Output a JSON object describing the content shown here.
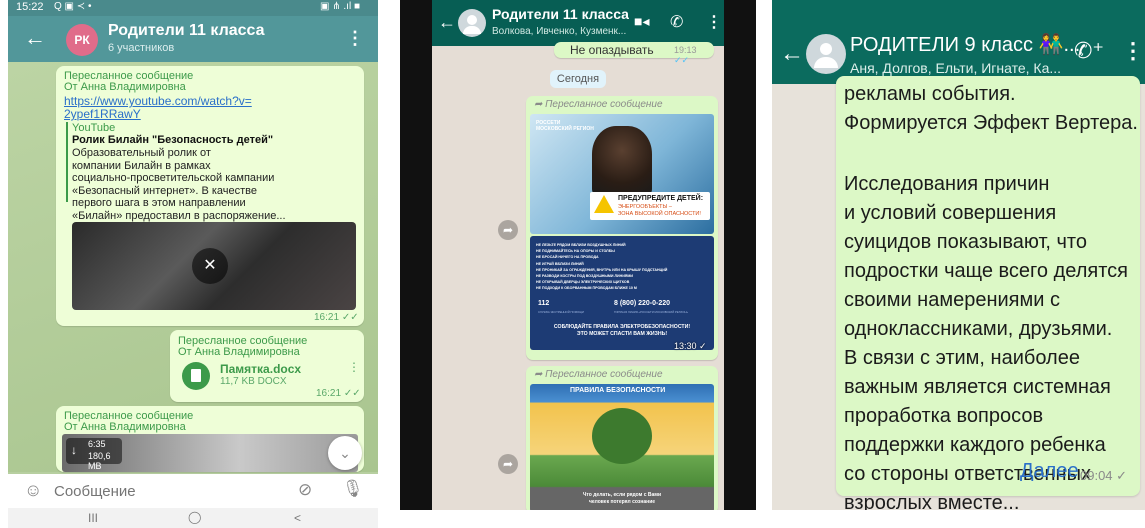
{
  "panel1": {
    "status": {
      "time": "15:22",
      "left_icons": "Q ▣ ≺ •",
      "right_icons": "▣ ⋔ .ıl ■"
    },
    "chat": {
      "avatar_initials": "РК",
      "title": "Родители 11 класса",
      "subtitle": "6 участников",
      "avatar_color": "#e06c8a"
    },
    "msg1": {
      "fwd_label": "Пересланное сообщение",
      "fwd_from": "От Анна Владимировна",
      "link": "https://www.youtube.com/watch?v=\n2ypef1RRawY",
      "source": "YouTube",
      "title": "Ролик Билайн \"Безопасность детей\"",
      "body": "Образовательный ролик от\nкомпании Билайн в рамках\nсоциально-просветительской кампании\n«Безопасный интернет». В качестве\nпервого шага в этом направлении\n«Билайн» предоставил в распоряжение...",
      "time": "16:21"
    },
    "msg2": {
      "fwd_label": "Пересланное сообщение",
      "fwd_from": "От Анна Владимировна",
      "file_name": "Памятка.docx",
      "file_meta": "11,7 KB DOCX",
      "time": "16:21"
    },
    "msg3": {
      "fwd_label": "Пересланное сообщение",
      "fwd_from": "От Анна Владимировна",
      "duration": "6:35",
      "size": "180,6 MB"
    },
    "input": {
      "placeholder": "Сообщение"
    },
    "nav": {
      "recents": "III",
      "home": "◯",
      "back": "<"
    }
  },
  "panel2": {
    "chat": {
      "title": "Родители 11 класса",
      "subtitle": "Волкова, Ивченко, Кузменк..."
    },
    "prev_snippet": "Не опаздывать",
    "prev_time": "19:13",
    "date_chip": "Сегодня",
    "msg1": {
      "fwd_label": "Пересланное сообщение",
      "poster_org": "РОССЕТИ\nМОСКОВСКИЙ РЕГИОН",
      "poster_heading": "ПРЕДУПРЕДИТЕ ДЕТЕЙ:",
      "poster_sub": "ЭНЕРГООБЪЕКТЫ –\nЗОНА ВЫСОКОЙ ОПАСНОСТИ!",
      "rules": [
        "НЕ ЛЕЗЬТЕ РЯДОМ ВБЛИЗИ ВОЗДУШНЫХ ЛИНИЙ",
        "НЕ ПОДНИМАЙТЕСЬ НА ОПОРЫ И СТОЛБЫ",
        "НЕ БРОСАЙ НИЧЕГО НА ПРОВОДА",
        "НЕ ИГРАЙ ВБЛИЗИ ЛИНИЙ",
        "НЕ ПРОНИКАЙ ЗА ОГРАЖДЕНИЯ, ВНУТРЬ ИЛИ НА КРЫШУ ПОДСТАНЦИЙ",
        "НЕ РАЗВОДИ КОСТРЫ ПОД ВОЗДУШНЫМИ ЛИНИЯМИ",
        "НЕ ОТКРЫВАЙ ДВЕРЦЫ ЭЛЕКТРИЧЕСКИХ ЩИТКОВ",
        "НЕ ПОДХОДИ К ОБОРВАННЫМ ПРОВОДАМ БЛИЖЕ 10 М"
      ],
      "phone_a": "112",
      "phone_b": "8 (800) 220-0-220",
      "phone_a_caption": "СЛУЖБА ЭКСТРЕННОЙ ПОМОЩИ",
      "phone_b_caption": "ГОРЯЧАЯ ЛИНИЯ «РОССЕТИ МОСКОВСКИЙ РЕГИОН»",
      "footer": "СОБЛЮДАЙТЕ ПРАВИЛА ЭЛЕКТРОБЕЗОПАСНОСТИ!\nЭТО МОЖЕТ СПАСТИ ВАМ ЖИЗНЬ!",
      "time": "13:30"
    },
    "msg2": {
      "fwd_label": "Пересланное сообщение",
      "poster_title": "ПРАВИЛА БЕЗОПАСНОСТИ",
      "poster_footer": "Что делать, если рядом с Вами\nчеловек потерял сознание"
    }
  },
  "panel3": {
    "chat": {
      "title": "РОДИТЕЛИ 9 класс",
      "title_suffix": "...",
      "subtitle": "Аня, Долгов, Ельти, Игнате, Ка..."
    },
    "message": {
      "top_text": "рекламы события.\nФормируется Эффект Вертера.",
      "main_text": "Исследования причин\nи условий совершения\nсуицидов показывают, что\nподростки чаще всего делятся\nсвоими намерениями с\nодноклассниками, друзьями.\nВ связи с этим, наиболее\nважным является системная\nпроработка вопросов\nподдержки каждого ребенка\nсо стороны ответственных\nвзрослых вместе...",
      "more_link": "Далее",
      "time": "09:04"
    }
  },
  "colors": {
    "telegram_header": "#52979a",
    "whatsapp_header": "#075e54",
    "whatsapp_header_light": "#0b6b5e",
    "bubble_green": "#dcf8c6",
    "link_blue": "#2a6fc9"
  }
}
